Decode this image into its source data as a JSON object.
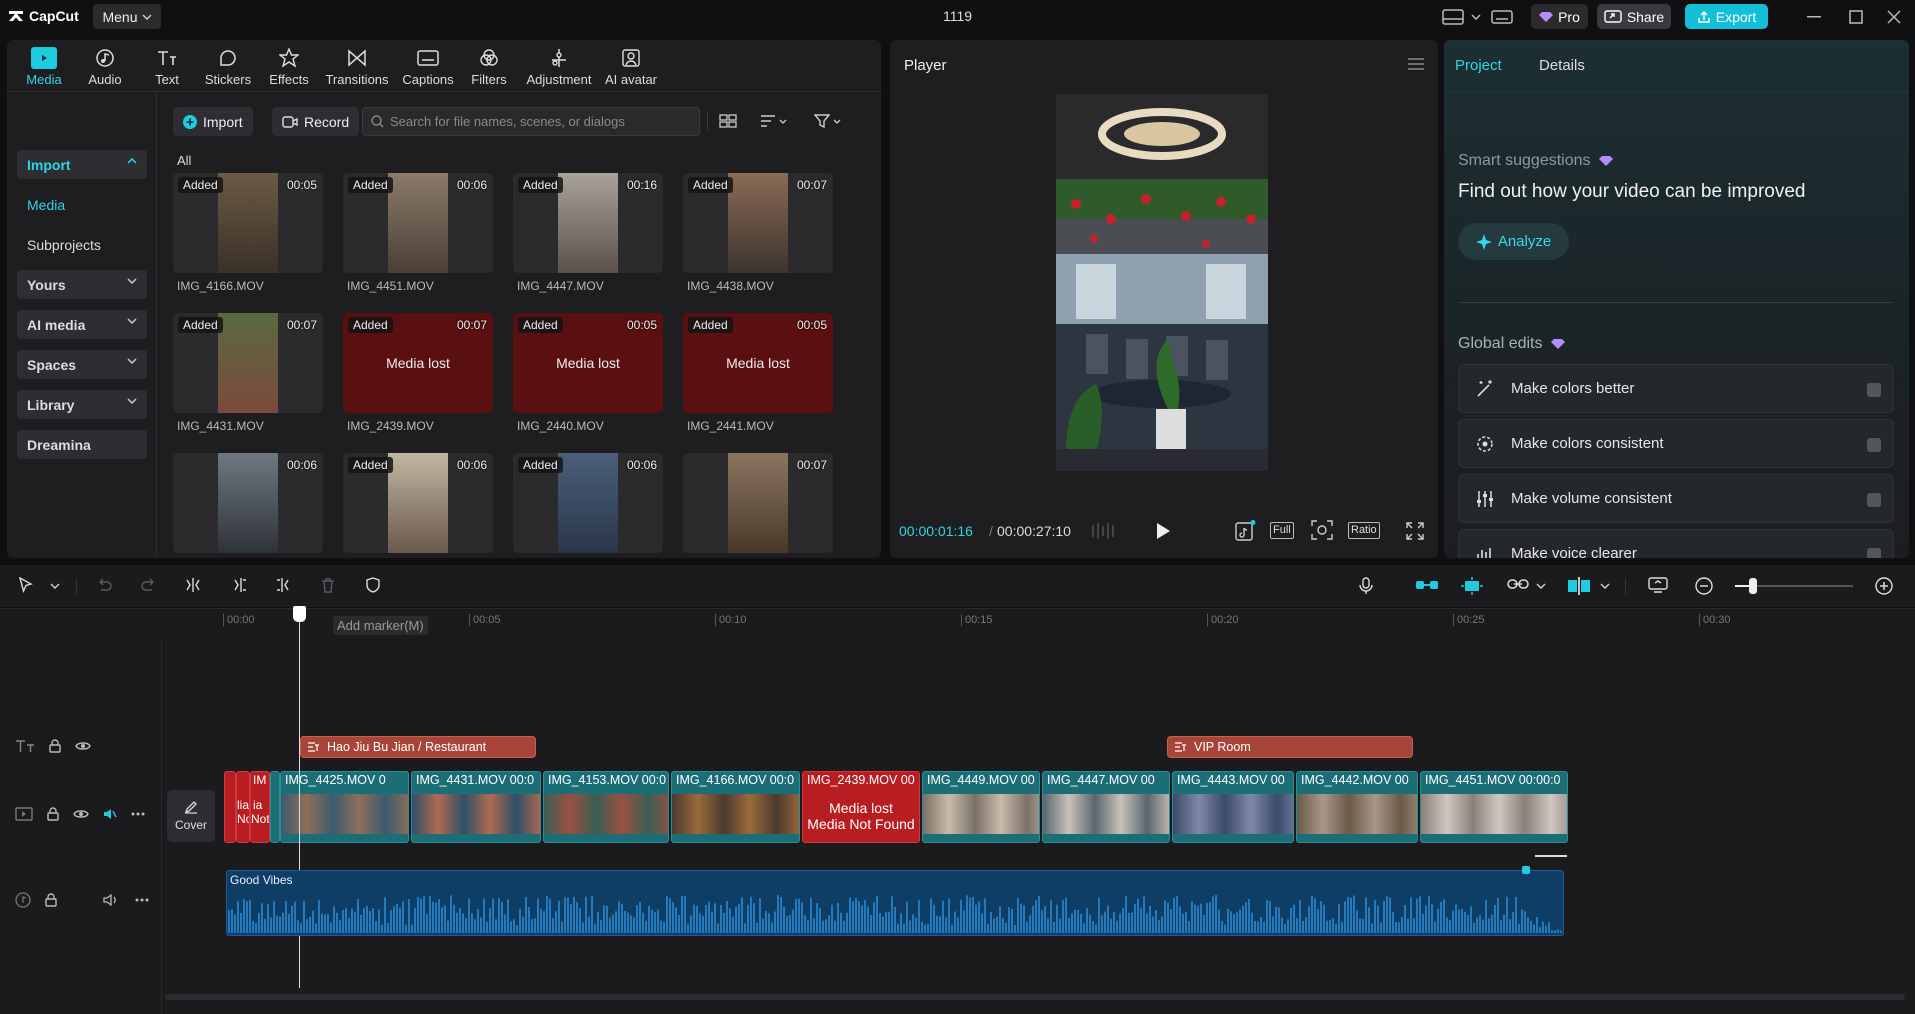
{
  "app": {
    "name": "CapCut",
    "menu_label": "Menu",
    "project_title": "1119"
  },
  "titlebar": {
    "pro_label": "Pro",
    "share_label": "Share",
    "export_label": "Export"
  },
  "toolbar": {
    "tabs": [
      {
        "label": "Media",
        "icon": "media-icon"
      },
      {
        "label": "Audio",
        "icon": "audio-icon"
      },
      {
        "label": "Text",
        "icon": "text-icon"
      },
      {
        "label": "Stickers",
        "icon": "stickers-icon"
      },
      {
        "label": "Effects",
        "icon": "effects-icon"
      },
      {
        "label": "Transitions",
        "icon": "transitions-icon"
      },
      {
        "label": "Captions",
        "icon": "captions-icon"
      },
      {
        "label": "Filters",
        "icon": "filters-icon"
      },
      {
        "label": "Adjustment",
        "icon": "adjustment-icon"
      },
      {
        "label": "AI avatar",
        "icon": "ai-avatar-icon"
      }
    ]
  },
  "sidebar": {
    "items": [
      {
        "label": "Import"
      },
      {
        "label": "Media"
      },
      {
        "label": "Subprojects"
      },
      {
        "label": "Yours"
      },
      {
        "label": "AI media"
      },
      {
        "label": "Spaces"
      },
      {
        "label": "Library"
      },
      {
        "label": "Dreamina"
      }
    ]
  },
  "media": {
    "import_label": "Import",
    "record_label": "Record",
    "search_placeholder": "Search for file names, scenes, or dialogs",
    "filter_label": "All",
    "added_label": "Added",
    "lost_label": "Media lost",
    "items": [
      {
        "name": "IMG_4166.MOV",
        "duration": "00:05",
        "added": true,
        "lost": false
      },
      {
        "name": "IMG_4451.MOV",
        "duration": "00:06",
        "added": true,
        "lost": false
      },
      {
        "name": "IMG_4447.MOV",
        "duration": "00:16",
        "added": true,
        "lost": false
      },
      {
        "name": "IMG_4438.MOV",
        "duration": "00:07",
        "added": true,
        "lost": false
      },
      {
        "name": "IMG_4431.MOV",
        "duration": "00:07",
        "added": true,
        "lost": false
      },
      {
        "name": "IMG_2439.MOV",
        "duration": "00:07",
        "added": true,
        "lost": true
      },
      {
        "name": "IMG_2440.MOV",
        "duration": "00:05",
        "added": true,
        "lost": true
      },
      {
        "name": "IMG_2441.MOV",
        "duration": "00:05",
        "added": true,
        "lost": true
      },
      {
        "name": "",
        "duration": "00:06",
        "added": false,
        "lost": false
      },
      {
        "name": "",
        "duration": "00:06",
        "added": true,
        "lost": false
      },
      {
        "name": "",
        "duration": "00:06",
        "added": true,
        "lost": false
      },
      {
        "name": "",
        "duration": "00:07",
        "added": false,
        "lost": false
      }
    ]
  },
  "player": {
    "title": "Player",
    "current_time": "00:00:01:16",
    "separator": "/",
    "total_time": "00:00:27:10",
    "full_label": "Full",
    "ratio_label": "Ratio"
  },
  "rightpanel": {
    "tabs": [
      {
        "label": "Project"
      },
      {
        "label": "Details"
      }
    ],
    "smart_suggestions_label": "Smart suggestions",
    "headline": "Find out how your video can be improved",
    "analyze_label": "Analyze",
    "global_edits_label": "Global edits",
    "global_edits": [
      {
        "label": "Make colors better",
        "icon": "magic-wand-icon"
      },
      {
        "label": "Make colors consistent",
        "icon": "color-sync-icon"
      },
      {
        "label": "Make volume consistent",
        "icon": "sliders-icon"
      },
      {
        "label": "Make voice clearer",
        "icon": "voice-icon"
      }
    ]
  },
  "timeline": {
    "ruler": [
      "00:00",
      "00:05",
      "00:10",
      "00:15",
      "00:20",
      "00:25",
      "00:30"
    ],
    "marker_tooltip": "Add marker(M)",
    "cover_label": "Cover",
    "text_clips": [
      {
        "label": "Hao Jiu Bu Jian / Restaurant"
      },
      {
        "label": "VIP Room"
      }
    ],
    "video_clips": [
      {
        "label": "IM",
        "lost": true
      },
      {
        "label": "IMG_4425.MOV  0",
        "lost": false
      },
      {
        "label": "IMG_4431.MOV  00:0",
        "lost": false
      },
      {
        "label": "IMG_4153.MOV  00:0",
        "lost": false
      },
      {
        "label": "IMG_4166.MOV  00:0",
        "lost": false
      },
      {
        "label": "IMG_2439.MOV  00",
        "lost": true
      },
      {
        "label": "IMG_4449.MOV  00",
        "lost": false
      },
      {
        "label": "IMG_4447.MOV  00",
        "lost": false
      },
      {
        "label": "IMG_4443.MOV  00",
        "lost": false
      },
      {
        "label": "IMG_4442.MOV  00",
        "lost": false
      },
      {
        "label": "IMG_4451.MOV  00:00:0",
        "lost": false
      }
    ],
    "lost_clip_line1": "Media lost",
    "lost_clip_line2": "Media Not Found",
    "lost_small_1": "lia",
    "lost_small_2": "No",
    "lost_small_3": "ia",
    "lost_small_4": "Not",
    "audio_label": "Good Vibes"
  }
}
